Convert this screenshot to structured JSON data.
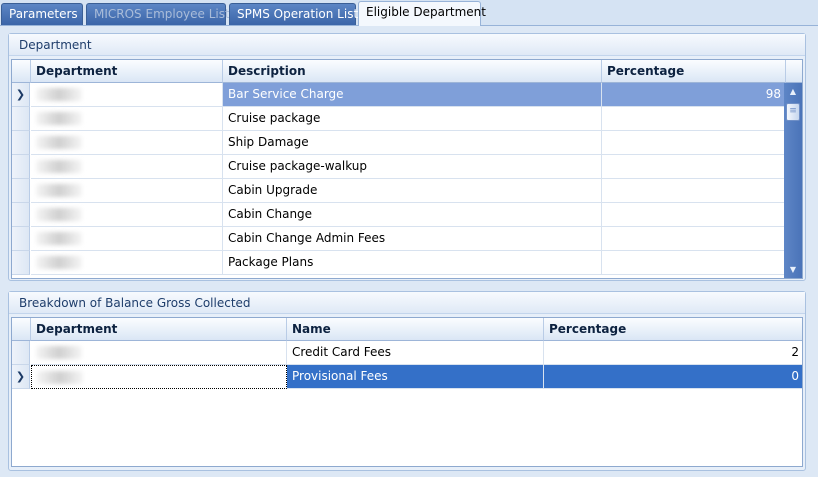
{
  "tabs": [
    {
      "label": "Parameters",
      "state": "normal"
    },
    {
      "label": "MICROS Employee List",
      "state": "disabled"
    },
    {
      "label": "SPMS Operation List",
      "state": "normal"
    },
    {
      "label": "Eligible Department",
      "state": "active"
    }
  ],
  "department_group": {
    "title": "Department",
    "columns": {
      "department": "Department",
      "description": "Description",
      "percentage": "Percentage"
    },
    "rows": [
      {
        "description": "Bar Service Charge",
        "percentage": "98",
        "selected": true
      },
      {
        "description": "Cruise package",
        "percentage": ""
      },
      {
        "description": "Ship Damage",
        "percentage": ""
      },
      {
        "description": "Cruise package-walkup",
        "percentage": ""
      },
      {
        "description": "Cabin Upgrade",
        "percentage": ""
      },
      {
        "description": "Cabin Change",
        "percentage": ""
      },
      {
        "description": "Cabin Change Admin Fees",
        "percentage": ""
      },
      {
        "description": "Package Plans",
        "percentage": ""
      }
    ]
  },
  "breakdown_group": {
    "title": "Breakdown of Balance Gross Collected",
    "columns": {
      "department": "Department",
      "name": "Name",
      "percentage": "Percentage"
    },
    "rows": [
      {
        "name": "Credit Card Fees",
        "percentage": "2"
      },
      {
        "name": "Provisional Fees",
        "percentage": "0",
        "selected": true
      }
    ]
  },
  "icons": {
    "row_indicator": "chevron-right-icon",
    "scroll_up": "scroll-up-arrow-icon",
    "scroll_down": "scroll-down-arrow-icon",
    "scroll_thumb": "scroll-thumb-grip-icon"
  },
  "colors": {
    "tab_blue": "#4a74b6",
    "selected_row_light": "#7f9fd9",
    "selected_row_dark": "#3470c8",
    "panel_background": "#d5e3f3"
  }
}
